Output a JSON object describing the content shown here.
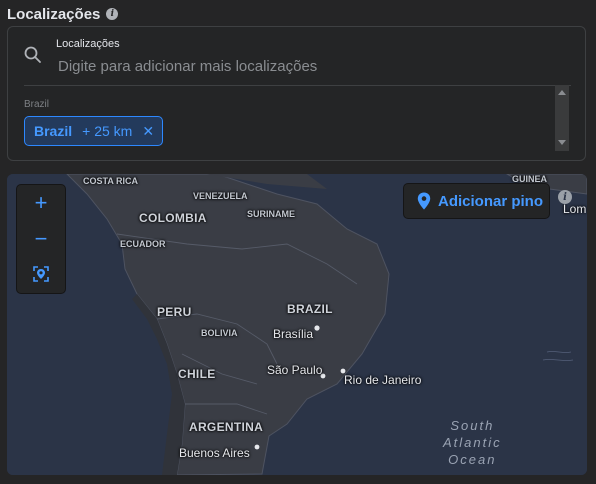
{
  "section": {
    "title": "Localizações"
  },
  "search": {
    "label": "Localizações",
    "placeholder": "Digite para adicionar mais localizações"
  },
  "selected": {
    "group_label": "Brazil",
    "chips": [
      {
        "name": "Brazil",
        "radius": "+ 25 km"
      }
    ]
  },
  "map": {
    "add_pin_label": "Adicionar pino",
    "zoom_in": "+",
    "zoom_out": "−",
    "countries": {
      "costa_rica": "COSTA RICA",
      "guinea": "GUINEA",
      "venezuela": "VENEZUELA",
      "colombia": "COLOMBIA",
      "suriname": "SURINAME",
      "ecuador": "ECUADOR",
      "brazil": "BRAZIL",
      "peru": "PERU",
      "bolivia": "BOLIVIA",
      "chile": "CHILE",
      "argentina": "ARGENTINA"
    },
    "cities": {
      "brasilia": "Brasília",
      "sao_paulo": "São Paulo",
      "rio": "Rio de Janeiro",
      "buenos_aires": "Buenos Aires",
      "lom": "Lom"
    },
    "ocean": {
      "line1": "South",
      "line2": "Atlantic",
      "line3": "Ocean"
    }
  },
  "colors": {
    "accent": "#4599ff",
    "chip_bg": "#233a5c",
    "panel": "#242526",
    "map_water": "#2b3447",
    "map_land": "#3a3d45"
  },
  "icons": [
    "info-icon",
    "search-icon",
    "close-icon",
    "location-pin-icon",
    "locate-icon"
  ]
}
